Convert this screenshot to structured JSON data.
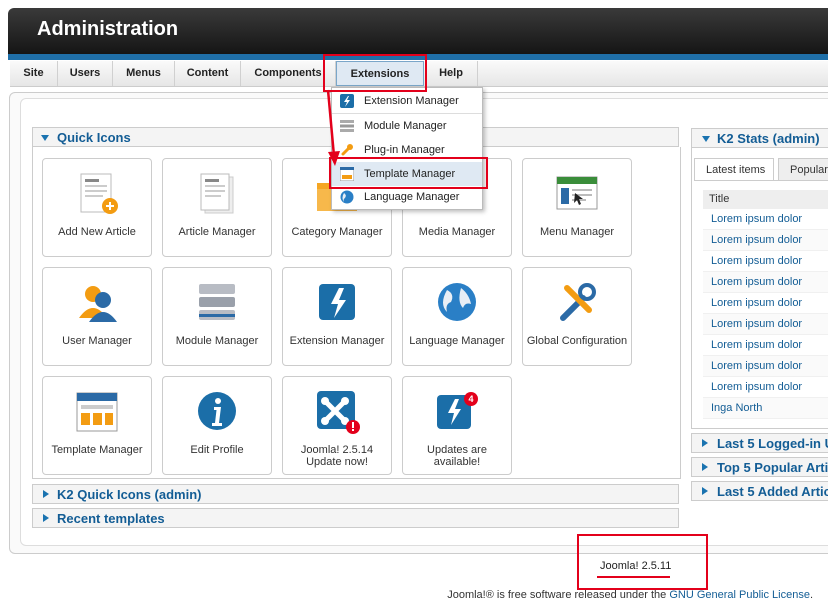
{
  "header": {
    "title": "Administration"
  },
  "menu": [
    {
      "label": "Site"
    },
    {
      "label": "Users"
    },
    {
      "label": "Menus"
    },
    {
      "label": "Content"
    },
    {
      "label": "Components"
    },
    {
      "label": "Extensions"
    },
    {
      "label": "Help"
    }
  ],
  "extensions_menu": [
    {
      "label": "Extension Manager",
      "icon": "extension-icon"
    },
    {
      "label": "Module Manager",
      "icon": "module-icon"
    },
    {
      "label": "Plug-in Manager",
      "icon": "plugin-icon"
    },
    {
      "label": "Template Manager",
      "icon": "template-icon"
    },
    {
      "label": "Language Manager",
      "icon": "language-icon"
    }
  ],
  "quick_icons": {
    "title": "Quick Icons",
    "tiles": [
      {
        "label": "Add New Article",
        "icon": "add-article-icon"
      },
      {
        "label": "Article Manager",
        "icon": "article-manager-icon"
      },
      {
        "label": "Category Manager",
        "icon": "category-manager-icon"
      },
      {
        "label": "Media Manager",
        "icon": "media-manager-icon"
      },
      {
        "label": "Menu Manager",
        "icon": "menu-manager-icon"
      },
      {
        "label": "User Manager",
        "icon": "user-manager-icon"
      },
      {
        "label": "Module Manager",
        "icon": "module-manager-icon"
      },
      {
        "label": "Extension Manager",
        "icon": "extension-manager-icon"
      },
      {
        "label": "Language Manager",
        "icon": "language-manager-icon"
      },
      {
        "label": "Global Configuration",
        "icon": "global-configuration-icon"
      },
      {
        "label": "Template Manager",
        "icon": "template-manager-icon"
      },
      {
        "label": "Edit Profile",
        "icon": "edit-profile-icon"
      },
      {
        "label": "Joomla! 2.5.14\nUpdate now!",
        "icon": "joomla-update-icon"
      },
      {
        "label": "Updates are\navailable!",
        "icon": "updates-available-icon"
      }
    ]
  },
  "collapsed_sections": [
    {
      "label": "K2 Quick Icons (admin)"
    },
    {
      "label": "Recent templates"
    }
  ],
  "k2_stats": {
    "title": "K2 Stats (admin)",
    "tabs": [
      "Latest items",
      "Popular"
    ],
    "column": "Title",
    "rows": [
      "Lorem ipsum dolor",
      "Lorem ipsum dolor",
      "Lorem ipsum dolor",
      "Lorem ipsum dolor",
      "Lorem ipsum dolor",
      "Lorem ipsum dolor",
      "Lorem ipsum dolor",
      "Lorem ipsum dolor",
      "Lorem ipsum dolor",
      "Inga North"
    ],
    "more_sections": [
      "Last 5 Logged-in U",
      "Top 5 Popular Arti",
      "Last 5 Added Artic"
    ]
  },
  "version": "Joomla! 2.5.11",
  "footer": {
    "prefix": "Joomla!® is free software released under the ",
    "link": "GNU General Public License",
    "suffix": "."
  },
  "colors": {
    "accent": "#135d95",
    "highlight": "#e3001b",
    "header_stripe": "#1f6fa8"
  }
}
